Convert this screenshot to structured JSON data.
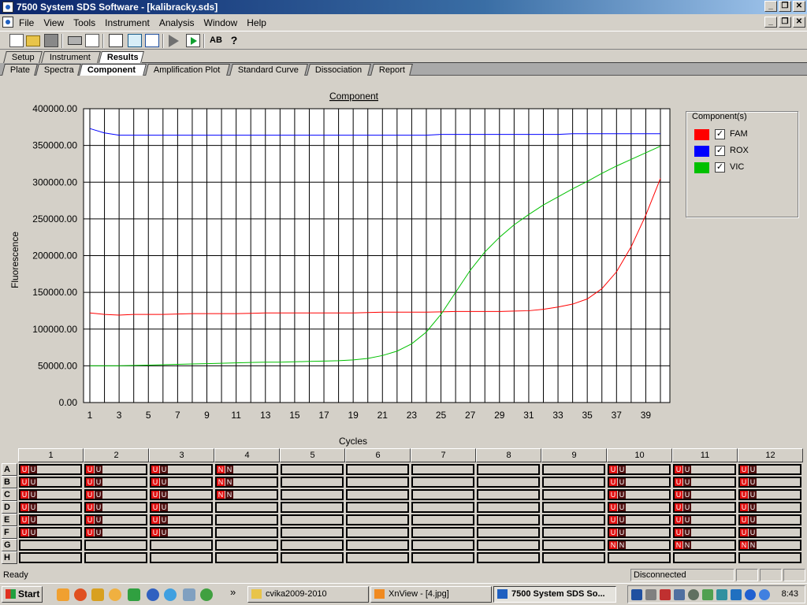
{
  "window": {
    "title": "7500 System SDS Software - [kalibracky.sds]"
  },
  "window_buttons": [
    "_",
    "❐",
    "✕"
  ],
  "menu": [
    "File",
    "View",
    "Tools",
    "Instrument",
    "Analysis",
    "Window",
    "Help"
  ],
  "toolbar": {
    "ab_label": "AB",
    "help_label": "?"
  },
  "tabs_top": [
    {
      "label": "Setup"
    },
    {
      "label": "Instrument"
    },
    {
      "label": "Results",
      "active": true
    }
  ],
  "tabs_sub": [
    {
      "label": "Plate"
    },
    {
      "label": "Spectra"
    },
    {
      "label": "Component",
      "active": true
    },
    {
      "label": "Amplification Plot"
    },
    {
      "label": "Standard Curve"
    },
    {
      "label": "Dissociation"
    },
    {
      "label": "Report"
    }
  ],
  "chart_data": {
    "type": "line",
    "title": "Component",
    "xlabel": "Cycles",
    "ylabel": "Fluorescence",
    "xlim": [
      1,
      40
    ],
    "ylim": [
      0,
      400000
    ],
    "x_ticks": [
      1,
      3,
      5,
      7,
      9,
      11,
      13,
      15,
      17,
      19,
      21,
      23,
      25,
      27,
      29,
      31,
      33,
      35,
      37,
      39
    ],
    "y_tick_labels": [
      "400000.00",
      "350000.00",
      "300000.00",
      "250000.00",
      "200000.00",
      "150000.00",
      "100000.00",
      "50000.00",
      "0.00"
    ],
    "y_ticks": [
      400000,
      350000,
      300000,
      250000,
      200000,
      150000,
      100000,
      50000,
      0
    ],
    "grid": "vertical lines at every cycle, horizontal lines at every y tick",
    "x": [
      1,
      2,
      3,
      4,
      5,
      6,
      7,
      8,
      9,
      10,
      11,
      12,
      13,
      14,
      15,
      16,
      17,
      18,
      19,
      20,
      21,
      22,
      23,
      24,
      25,
      26,
      27,
      28,
      29,
      30,
      31,
      32,
      33,
      34,
      35,
      36,
      37,
      38,
      39,
      40
    ],
    "series": [
      {
        "name": "FAM",
        "color": "#ff0000",
        "values": [
          122000,
          120000,
          119000,
          120000,
          120000,
          120000,
          120500,
          121000,
          121000,
          121000,
          121000,
          121500,
          122000,
          122000,
          122000,
          122000,
          122000,
          122000,
          122000,
          122500,
          123000,
          123000,
          123000,
          123000,
          123500,
          124000,
          124000,
          124000,
          124000,
          124500,
          125000,
          127000,
          130000,
          134000,
          141000,
          155000,
          178000,
          212000,
          255000,
          305000
        ]
      },
      {
        "name": "ROX",
        "color": "#0000ff",
        "values": [
          373000,
          367000,
          364000,
          364000,
          364000,
          364000,
          364000,
          364000,
          364000,
          364000,
          364000,
          364000,
          364000,
          364000,
          364000,
          364000,
          364000,
          364000,
          364000,
          364000,
          364000,
          364000,
          364000,
          364000,
          365000,
          365000,
          365000,
          365000,
          365000,
          365000,
          365000,
          365000,
          365000,
          366000,
          366000,
          366000,
          366000,
          366000,
          366000,
          366000
        ]
      },
      {
        "name": "VIC",
        "color": "#00c000",
        "values": [
          50000,
          50000,
          50000,
          50500,
          51000,
          51500,
          52000,
          52500,
          53000,
          53500,
          54000,
          54500,
          55000,
          55000,
          55500,
          56000,
          56500,
          57000,
          58000,
          60000,
          64000,
          70000,
          80000,
          96000,
          120000,
          150000,
          180000,
          205000,
          225000,
          242000,
          256000,
          269000,
          280000,
          291000,
          301000,
          312000,
          322000,
          331000,
          340000,
          349000
        ]
      }
    ]
  },
  "legend": {
    "title": "Component(s)",
    "items": [
      {
        "label": "FAM",
        "color": "#ff0000",
        "checked": "✓"
      },
      {
        "label": "ROX",
        "color": "#0000ff",
        "checked": "✓"
      },
      {
        "label": "VIC",
        "color": "#00c000",
        "checked": "✓"
      }
    ]
  },
  "plate": {
    "columns": [
      "1",
      "2",
      "3",
      "4",
      "5",
      "6",
      "7",
      "8",
      "9",
      "10",
      "11",
      "12"
    ],
    "rows": [
      "A",
      "B",
      "C",
      "D",
      "E",
      "F",
      "G",
      "H"
    ],
    "wells": {
      "A": [
        "UU",
        "UU",
        "UU",
        "NN",
        "",
        "",
        "",
        "",
        "",
        "UU",
        "UU",
        "UU"
      ],
      "B": [
        "UU",
        "UU",
        "UU",
        "NN",
        "",
        "",
        "",
        "",
        "",
        "UU",
        "UU",
        "UU"
      ],
      "C": [
        "UU",
        "UU",
        "UU",
        "NN",
        "",
        "",
        "",
        "",
        "",
        "UU",
        "UU",
        "UU"
      ],
      "D": [
        "UU",
        "UU",
        "UU",
        "",
        "",
        "",
        "",
        "",
        "",
        "UU",
        "UU",
        "UU"
      ],
      "E": [
        "UU",
        "UU",
        "UU",
        "",
        "",
        "",
        "",
        "",
        "",
        "UU",
        "UU",
        "UU"
      ],
      "F": [
        "UU",
        "UU",
        "UU",
        "",
        "",
        "",
        "",
        "",
        "",
        "UU",
        "UU",
        "UU"
      ],
      "G": [
        "",
        "",
        "",
        "",
        "",
        "",
        "",
        "",
        "",
        "NN",
        "NN",
        "NN"
      ],
      "H": [
        "",
        "",
        "",
        "",
        "",
        "",
        "",
        "",
        "",
        "",
        "",
        ""
      ]
    }
  },
  "status": {
    "left": "Ready",
    "connection": "Disconnected"
  },
  "taskbar": {
    "start": "Start",
    "overflow": "»",
    "buttons": [
      {
        "label": "cvika2009-2010",
        "icon_color": "#e8c44a"
      },
      {
        "label": "XnView - [4.jpg]",
        "icon_color": "#f08a20"
      },
      {
        "label": "7500 System SDS So...",
        "icon_color": "#2060c0",
        "active": true
      }
    ],
    "clock": "8:43"
  }
}
